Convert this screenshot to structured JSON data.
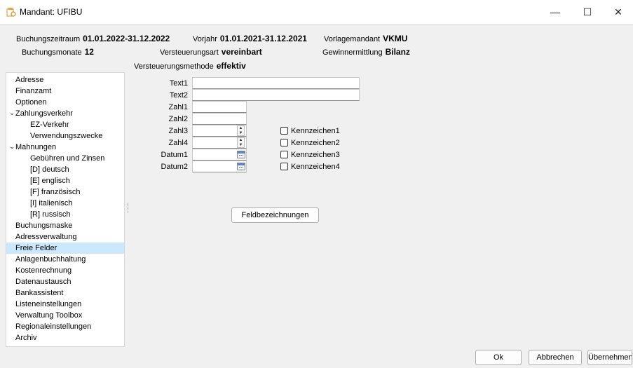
{
  "window": {
    "title": "Mandant: UFIBU",
    "controls": {
      "minimize": "—",
      "maximize": "☐",
      "close": "✕"
    }
  },
  "header": {
    "buchungszeitraum": {
      "label": "Buchungszeitraum",
      "value": "01.01.2022-31.12.2022"
    },
    "vorjahr": {
      "label": "Vorjahr",
      "value": "01.01.2021-31.12.2021"
    },
    "vorlagemandant": {
      "label": "Vorlagemandant",
      "value": "VKMU"
    },
    "buchungsmonate": {
      "label": "Buchungsmonate",
      "value": "12"
    },
    "versteuerungsart": {
      "label": "Versteuerungsart",
      "value": "vereinbart"
    },
    "gewinnermittlung": {
      "label": "Gewinnermittlung",
      "value": "Bilanz"
    },
    "versteuerungsmethode": {
      "label": "Versteuerungsmethode",
      "value": "effektiv"
    }
  },
  "nav": {
    "items": [
      {
        "label": "Adresse"
      },
      {
        "label": "Finanzamt"
      },
      {
        "label": "Optionen"
      },
      {
        "label": "Zahlungsverkehr",
        "expanded": true
      },
      {
        "label": "EZ-Verkehr"
      },
      {
        "label": "Verwendungszwecke"
      },
      {
        "label": "Mahnungen",
        "expanded": true
      },
      {
        "label": "Gebühren und Zinsen"
      },
      {
        "label": "[D] deutsch"
      },
      {
        "label": "[E] englisch"
      },
      {
        "label": "[F] französisch"
      },
      {
        "label": "[I] italienisch"
      },
      {
        "label": "[R] russisch"
      },
      {
        "label": "Buchungsmaske"
      },
      {
        "label": "Adressverwaltung"
      },
      {
        "label": "Freie Felder",
        "selected": true
      },
      {
        "label": "Anlagenbuchhaltung"
      },
      {
        "label": "Kostenrechnung"
      },
      {
        "label": "Datenaustausch"
      },
      {
        "label": "Bankassistent"
      },
      {
        "label": "Listeneinstellungen"
      },
      {
        "label": "Verwaltung Toolbox"
      },
      {
        "label": "Regionaleinstellungen"
      },
      {
        "label": "Archiv"
      }
    ],
    "chevron": "⌄"
  },
  "form": {
    "text1": {
      "label": "Text1",
      "value": ""
    },
    "text2": {
      "label": "Text2",
      "value": ""
    },
    "zahl1": {
      "label": "Zahl1",
      "value": ""
    },
    "zahl2": {
      "label": "Zahl2",
      "value": ""
    },
    "zahl3": {
      "label": "Zahl3",
      "value": ""
    },
    "zahl4": {
      "label": "Zahl4",
      "value": ""
    },
    "datum1": {
      "label": "Datum1",
      "value": ""
    },
    "datum2": {
      "label": "Datum2",
      "value": ""
    },
    "kennzeichen": [
      {
        "label": "Kennzeichen1",
        "checked": false
      },
      {
        "label": "Kennzeichen2",
        "checked": false
      },
      {
        "label": "Kennzeichen3",
        "checked": false
      },
      {
        "label": "Kennzeichen4",
        "checked": false
      }
    ],
    "feldbezeichnungen_label": "Feldbezeichnungen"
  },
  "footer": {
    "ok_label": "Ok",
    "abbrechen_label": "Abbrechen",
    "uebernehmen_label": "Übernehmen"
  },
  "colors": {
    "selected_bg": "#cce8ff",
    "icon_orange": "#e8a33c"
  }
}
